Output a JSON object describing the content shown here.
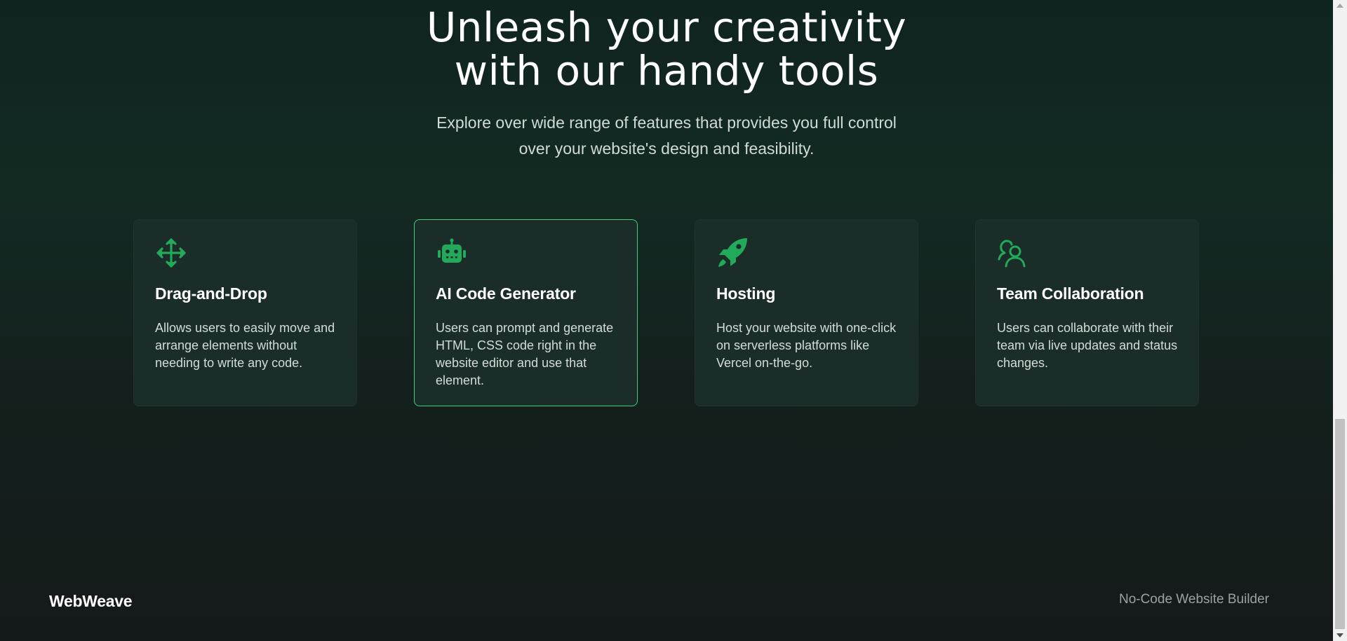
{
  "hero": {
    "title_line1": "Unleash your creativity",
    "title_line2": "with our handy tools",
    "subtitle_line1": "Explore over wide range of features that provides you full control",
    "subtitle_line2": "over your website's design and feasibility."
  },
  "features": [
    {
      "icon": "move-arrows-icon",
      "title": "Drag-and-Drop",
      "description": "Allows users to easily move and arrange elements without needing to write any code."
    },
    {
      "icon": "robot-icon",
      "title": "AI Code Generator",
      "description": "Users can prompt and generate HTML, CSS code right in the website editor and use that element."
    },
    {
      "icon": "rocket-icon",
      "title": "Hosting",
      "description": "Host your website with one-click on serverless platforms like Vercel on-the-go."
    },
    {
      "icon": "users-icon",
      "title": "Team Collaboration",
      "description": "Users can collaborate with their team via live updates and status changes."
    }
  ],
  "footer": {
    "brand": "WebWeave",
    "tagline": "No-Code Website Builder"
  },
  "colors": {
    "accent": "#22a95a",
    "active_border": "#3ed07a",
    "card_bg": "#1b2d28",
    "text_muted": "#9aa3a0"
  },
  "scroll": {
    "position_fraction": 0.67
  }
}
